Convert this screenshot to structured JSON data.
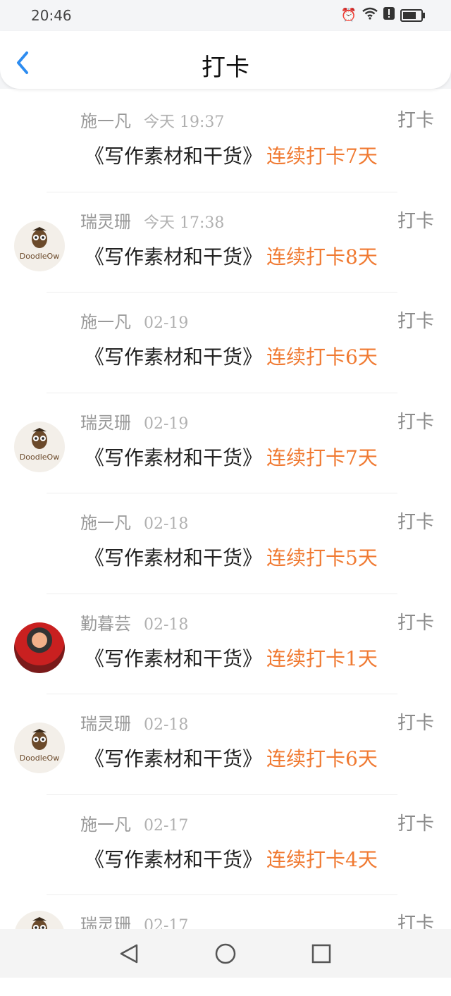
{
  "status_bar": {
    "time": "20:46"
  },
  "header": {
    "title": "打卡"
  },
  "items": [
    {
      "name": "施一凡",
      "time": "今天 19:37",
      "tag": "打卡",
      "book": "《写作素材和干货》",
      "streak": "连续打卡7天",
      "avatar": "none"
    },
    {
      "name": "瑞灵珊",
      "time": "今天 17:38",
      "tag": "打卡",
      "book": "《写作素材和干货》",
      "streak": "连续打卡8天",
      "avatar": "owl"
    },
    {
      "name": "施一凡",
      "time": "02-19",
      "tag": "打卡",
      "book": "《写作素材和干货》",
      "streak": "连续打卡6天",
      "avatar": "none"
    },
    {
      "name": "瑞灵珊",
      "time": "02-19",
      "tag": "打卡",
      "book": "《写作素材和干货》",
      "streak": "连续打卡7天",
      "avatar": "owl"
    },
    {
      "name": "施一凡",
      "time": "02-18",
      "tag": "打卡",
      "book": "《写作素材和干货》",
      "streak": "连续打卡5天",
      "avatar": "none"
    },
    {
      "name": "勤暮芸",
      "time": "02-18",
      "tag": "打卡",
      "book": "《写作素材和干货》",
      "streak": "连续打卡1天",
      "avatar": "photo"
    },
    {
      "name": "瑞灵珊",
      "time": "02-18",
      "tag": "打卡",
      "book": "《写作素材和干货》",
      "streak": "连续打卡6天",
      "avatar": "owl"
    },
    {
      "name": "施一凡",
      "time": "02-17",
      "tag": "打卡",
      "book": "《写作素材和干货》",
      "streak": "连续打卡4天",
      "avatar": "none"
    },
    {
      "name": "瑞灵珊",
      "time": "02-17",
      "tag": "打卡",
      "book": "",
      "streak": "",
      "avatar": "owl"
    }
  ],
  "avatar_logo_text": "DoodleOw",
  "colors": {
    "accent": "#f07a32",
    "back_arrow": "#2d8cf0"
  }
}
